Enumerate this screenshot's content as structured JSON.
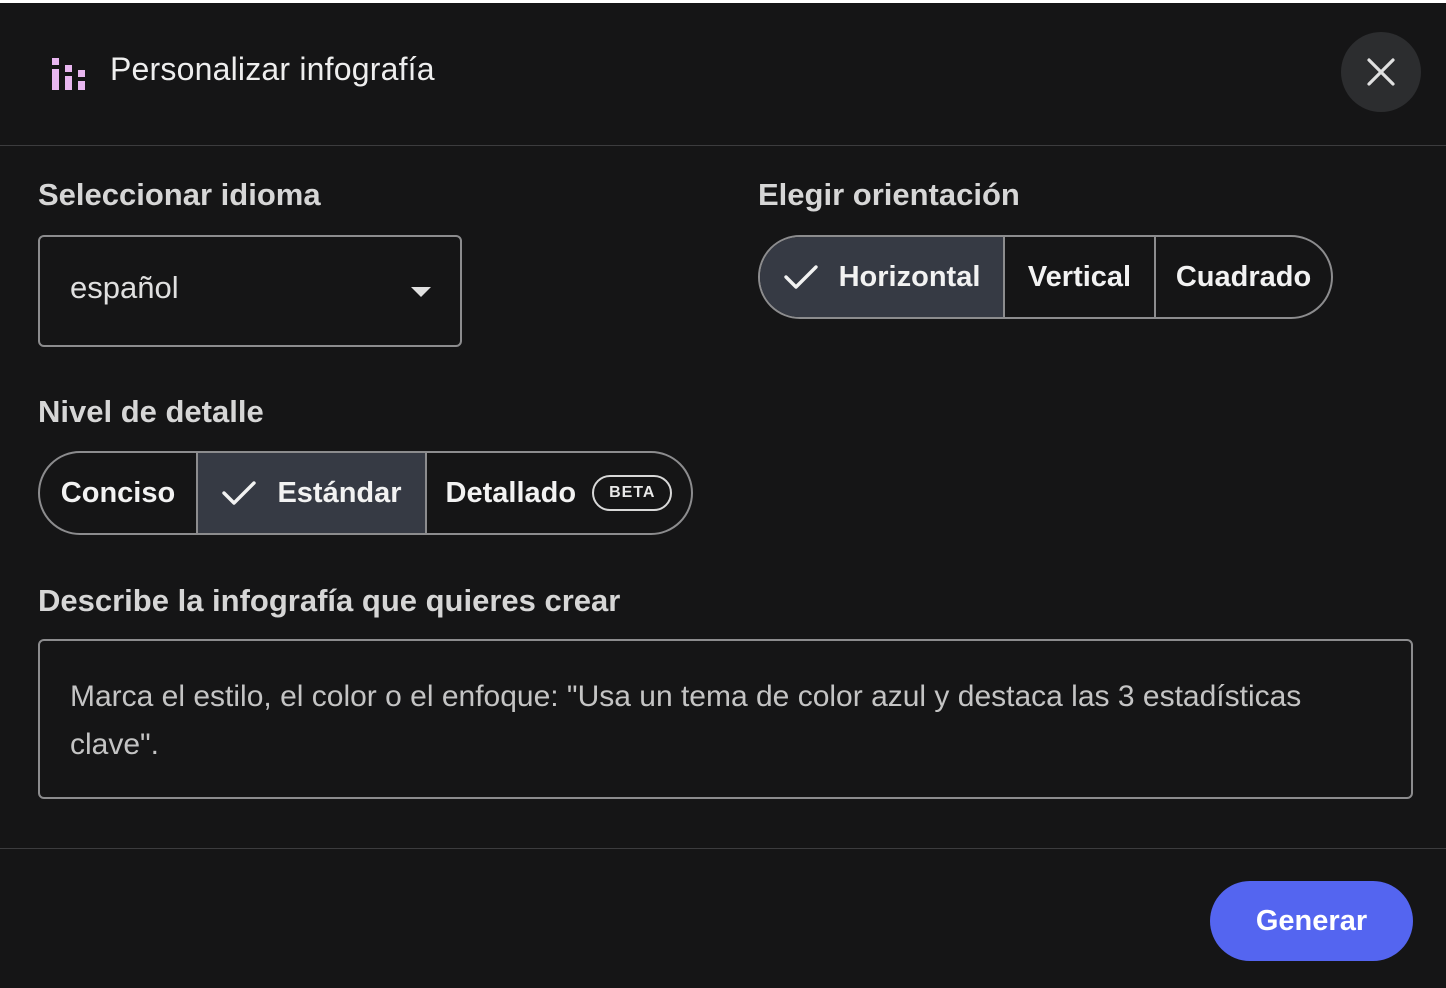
{
  "header": {
    "title": "Personalizar infografía",
    "icon": "infographic-icon",
    "close_icon": "close-icon"
  },
  "language": {
    "label": "Seleccionar idioma",
    "value": "español"
  },
  "orientation": {
    "label": "Elegir orientación",
    "options": [
      {
        "label": "Horizontal",
        "selected": true
      },
      {
        "label": "Vertical",
        "selected": false
      },
      {
        "label": "Cuadrado",
        "selected": false
      }
    ]
  },
  "detail": {
    "label": "Nivel de detalle",
    "options": [
      {
        "label": "Conciso",
        "selected": false
      },
      {
        "label": "Estándar",
        "selected": true
      },
      {
        "label": "Detallado",
        "selected": false,
        "badge": "BETA"
      }
    ]
  },
  "description": {
    "label": "Describe la infografía que quieres crear",
    "placeholder": "Marca el estilo, el color o el enfoque: \"Usa un tema de color azul y destaca las 3 estadísticas clave\"."
  },
  "footer": {
    "generate_label": "Generar"
  },
  "colors": {
    "background": "#151516",
    "accent": "#5465f0",
    "selected_segment": "#363a44",
    "icon_pink": "#e8b6f0"
  }
}
